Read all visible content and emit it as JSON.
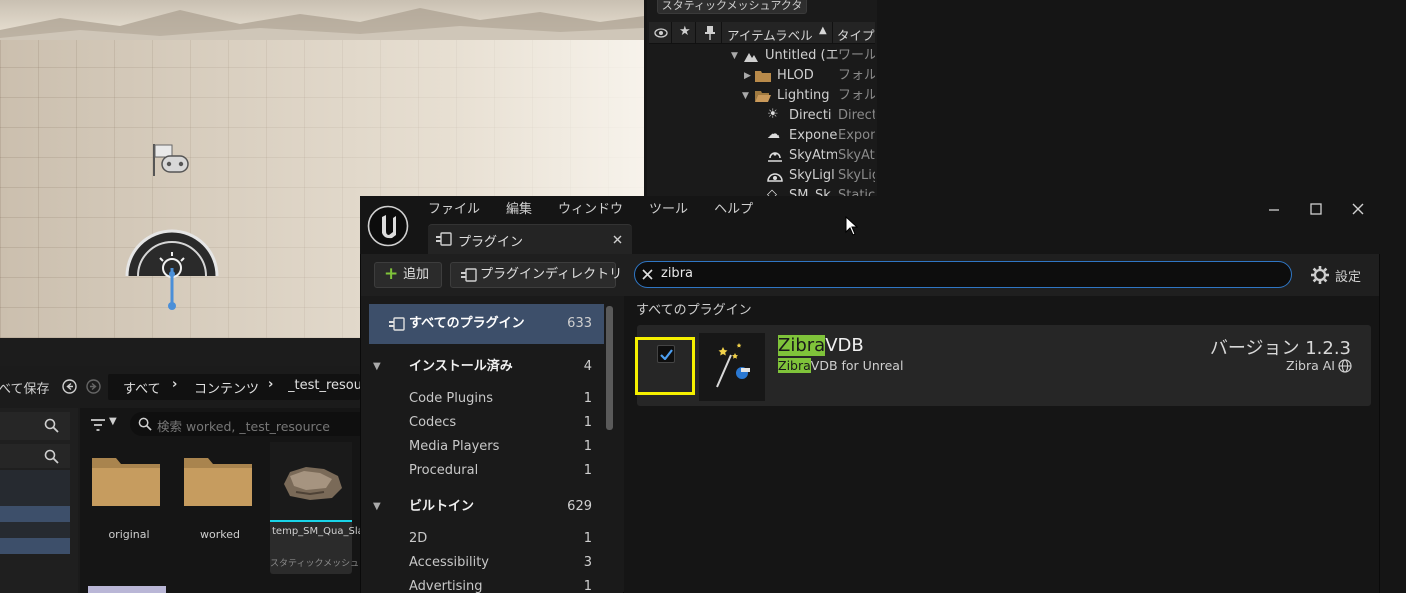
{
  "outliner": {
    "static_mesh_actor_btn": "スタティックメッシュアクタ",
    "header_label": "アイテムラベル",
    "header_type": "タイプ",
    "rows": [
      {
        "label": "Untitled (エ",
        "type": "ワール"
      },
      {
        "label": "HLOD",
        "type": "フォル"
      },
      {
        "label": "Lighting",
        "type": "フォル"
      },
      {
        "label": "Directi",
        "type": "Direct"
      },
      {
        "label": "Expone",
        "type": "Expon"
      },
      {
        "label": "SkyAtm",
        "type": "SkyAt"
      },
      {
        "label": "SkyLigl",
        "type": "SkyLig"
      },
      {
        "label": "SM_Sk",
        "type": "Static"
      }
    ]
  },
  "content_browser": {
    "save_all": "べて保存",
    "breadcrumb": [
      "すべて",
      "コンテンツ",
      "_test_resour"
    ],
    "search_placeholder": "検索 worked, _test_resource",
    "assets": [
      {
        "label": "original"
      },
      {
        "label": "worked"
      },
      {
        "label": "temp_SM_Qua_Sla_Ledge_...",
        "sub": "スタティックメッシュ"
      }
    ]
  },
  "plugin_window": {
    "menu": [
      "ファイル",
      "編集",
      "ウィンドウ",
      "ツール",
      "ヘルプ"
    ],
    "tab_label": "プラグイン",
    "add_button": "追加",
    "plugin_directory_button": "プラグインディレクトリ",
    "search_value": "zibra",
    "settings_label": "設定",
    "section_title": "すべてのプラグイン",
    "categories": [
      {
        "label": "すべてのプラグイン",
        "count": "633",
        "selected": true
      },
      {
        "label": "インストール済み",
        "count": "4",
        "group": true
      },
      {
        "label": "Code Plugins",
        "count": "1"
      },
      {
        "label": "Codecs",
        "count": "1"
      },
      {
        "label": "Media Players",
        "count": "1"
      },
      {
        "label": "Procedural",
        "count": "1"
      },
      {
        "label": "ビルトイン",
        "count": "629",
        "group": true
      },
      {
        "label": "2D",
        "count": "1"
      },
      {
        "label": "Accessibility",
        "count": "3"
      },
      {
        "label": "Advertising",
        "count": "1"
      }
    ],
    "plugin": {
      "name_highlight": "Zibra",
      "name_rest": "VDB",
      "desc_highlight": "Zibra",
      "desc_rest": "VDB for Unreal",
      "version": "バージョン 1.2.3",
      "vendor": "Zibra AI",
      "enabled": true
    }
  },
  "colors": {
    "accent_blue": "#2f76c4",
    "highlight_green": "#7fc33a",
    "callout_yellow": "#f5f000",
    "selected_row": "#3d4f6a"
  }
}
